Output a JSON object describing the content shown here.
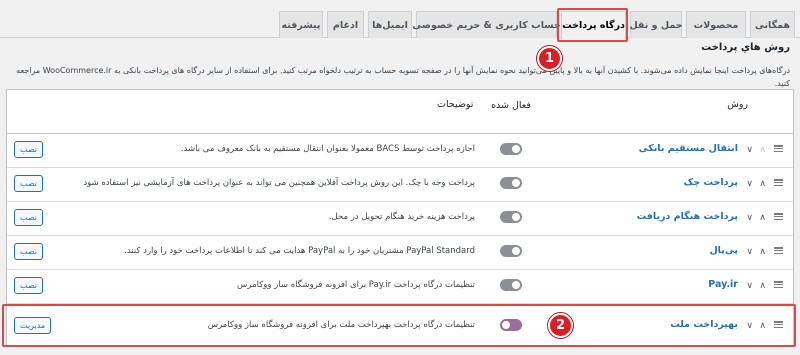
{
  "tabs": [
    {
      "label": "همگانی"
    },
    {
      "label": "محصولات"
    },
    {
      "label": "حمل و نقل"
    },
    {
      "label": "درگاه پرداخت"
    },
    {
      "label": "حساب کاربری & حریم خصوصی"
    },
    {
      "label": "ایمیل‌ها"
    },
    {
      "label": "ادغام"
    },
    {
      "label": "پیشرفته"
    }
  ],
  "section": {
    "title": "روش هاي پرداخت",
    "description": "درگاه‌های پرداخت اینجا نمایش داده می‌شوند. با کشیدن آنها به بالا و پایین می‌توانید نحوه نمایش آنها را در صفحه تسویه حساب به ترتیب دلخواه مرتب کنید. برای استفاده از سایر درگاه های پرداخت بانکی به WooCommerce.ir مراجعه کنید."
  },
  "table": {
    "headers": {
      "method": "روش",
      "enabled": "فعال شده",
      "description": "توضیحات"
    },
    "rows": [
      {
        "name": "انتقال مستقیم بانکی",
        "description": "اجازه پرداخت توسط BACS معمولا بعنوان انتقال مستقیم به بانک معروف می باشد.",
        "enabled": false,
        "action": "نصب"
      },
      {
        "name": "پرداخت چک",
        "description": "پرداخت وجه با چک. این روش پرداخت آفلاین همچنین می تواند به عنوان پرداخت های آزمایشی نیز استفاده شود",
        "enabled": false,
        "action": "نصب"
      },
      {
        "name": "پرداخت هنگام دریافت",
        "description": "پرداخت هزینه خرید هنگام تحویل در محل.",
        "enabled": false,
        "action": "نصب"
      },
      {
        "name": "پی‌پال",
        "description": "PayPal Standard مشتریان خود را به PayPal هدایت می کند تا اطلاعات پرداخت خود را وارد کنند.",
        "enabled": false,
        "action": "نصب"
      },
      {
        "name": "Pay.ir",
        "description": "تنظیمات درگاه پرداخت Pay.ir برای افزونه فروشگاه ساز ووکامرس",
        "enabled": false,
        "action": "نصب"
      },
      {
        "name": "بهپرداخت ملت",
        "description": "تنظیمات درگاه پرداخت بهپرداخت ملت برای افزونه فروشگاه ساز ووکامرس",
        "enabled": true,
        "action": "مدیریت"
      }
    ]
  },
  "annotations": {
    "badge_1": "1",
    "badge_2": "2"
  },
  "colors": {
    "link": "#2271b1",
    "annotation_red": "#e0474c",
    "toggle_on": "#9b6d9a",
    "toggle_off": "#8c8f94"
  }
}
